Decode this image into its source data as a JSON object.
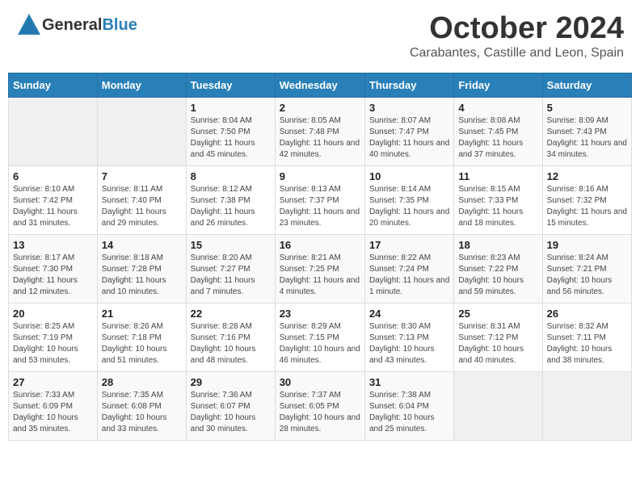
{
  "header": {
    "logo_general": "General",
    "logo_blue": "Blue",
    "month_title": "October 2024",
    "location": "Carabantes, Castille and Leon, Spain"
  },
  "days_of_week": [
    "Sunday",
    "Monday",
    "Tuesday",
    "Wednesday",
    "Thursday",
    "Friday",
    "Saturday"
  ],
  "weeks": [
    [
      {
        "day": "",
        "sunrise": "",
        "sunset": "",
        "daylight": ""
      },
      {
        "day": "",
        "sunrise": "",
        "sunset": "",
        "daylight": ""
      },
      {
        "day": "1",
        "sunrise": "Sunrise: 8:04 AM",
        "sunset": "Sunset: 7:50 PM",
        "daylight": "Daylight: 11 hours and 45 minutes."
      },
      {
        "day": "2",
        "sunrise": "Sunrise: 8:05 AM",
        "sunset": "Sunset: 7:48 PM",
        "daylight": "Daylight: 11 hours and 42 minutes."
      },
      {
        "day": "3",
        "sunrise": "Sunrise: 8:07 AM",
        "sunset": "Sunset: 7:47 PM",
        "daylight": "Daylight: 11 hours and 40 minutes."
      },
      {
        "day": "4",
        "sunrise": "Sunrise: 8:08 AM",
        "sunset": "Sunset: 7:45 PM",
        "daylight": "Daylight: 11 hours and 37 minutes."
      },
      {
        "day": "5",
        "sunrise": "Sunrise: 8:09 AM",
        "sunset": "Sunset: 7:43 PM",
        "daylight": "Daylight: 11 hours and 34 minutes."
      }
    ],
    [
      {
        "day": "6",
        "sunrise": "Sunrise: 8:10 AM",
        "sunset": "Sunset: 7:42 PM",
        "daylight": "Daylight: 11 hours and 31 minutes."
      },
      {
        "day": "7",
        "sunrise": "Sunrise: 8:11 AM",
        "sunset": "Sunset: 7:40 PM",
        "daylight": "Daylight: 11 hours and 29 minutes."
      },
      {
        "day": "8",
        "sunrise": "Sunrise: 8:12 AM",
        "sunset": "Sunset: 7:38 PM",
        "daylight": "Daylight: 11 hours and 26 minutes."
      },
      {
        "day": "9",
        "sunrise": "Sunrise: 8:13 AM",
        "sunset": "Sunset: 7:37 PM",
        "daylight": "Daylight: 11 hours and 23 minutes."
      },
      {
        "day": "10",
        "sunrise": "Sunrise: 8:14 AM",
        "sunset": "Sunset: 7:35 PM",
        "daylight": "Daylight: 11 hours and 20 minutes."
      },
      {
        "day": "11",
        "sunrise": "Sunrise: 8:15 AM",
        "sunset": "Sunset: 7:33 PM",
        "daylight": "Daylight: 11 hours and 18 minutes."
      },
      {
        "day": "12",
        "sunrise": "Sunrise: 8:16 AM",
        "sunset": "Sunset: 7:32 PM",
        "daylight": "Daylight: 11 hours and 15 minutes."
      }
    ],
    [
      {
        "day": "13",
        "sunrise": "Sunrise: 8:17 AM",
        "sunset": "Sunset: 7:30 PM",
        "daylight": "Daylight: 11 hours and 12 minutes."
      },
      {
        "day": "14",
        "sunrise": "Sunrise: 8:18 AM",
        "sunset": "Sunset: 7:28 PM",
        "daylight": "Daylight: 11 hours and 10 minutes."
      },
      {
        "day": "15",
        "sunrise": "Sunrise: 8:20 AM",
        "sunset": "Sunset: 7:27 PM",
        "daylight": "Daylight: 11 hours and 7 minutes."
      },
      {
        "day": "16",
        "sunrise": "Sunrise: 8:21 AM",
        "sunset": "Sunset: 7:25 PM",
        "daylight": "Daylight: 11 hours and 4 minutes."
      },
      {
        "day": "17",
        "sunrise": "Sunrise: 8:22 AM",
        "sunset": "Sunset: 7:24 PM",
        "daylight": "Daylight: 11 hours and 1 minute."
      },
      {
        "day": "18",
        "sunrise": "Sunrise: 8:23 AM",
        "sunset": "Sunset: 7:22 PM",
        "daylight": "Daylight: 10 hours and 59 minutes."
      },
      {
        "day": "19",
        "sunrise": "Sunrise: 8:24 AM",
        "sunset": "Sunset: 7:21 PM",
        "daylight": "Daylight: 10 hours and 56 minutes."
      }
    ],
    [
      {
        "day": "20",
        "sunrise": "Sunrise: 8:25 AM",
        "sunset": "Sunset: 7:19 PM",
        "daylight": "Daylight: 10 hours and 53 minutes."
      },
      {
        "day": "21",
        "sunrise": "Sunrise: 8:26 AM",
        "sunset": "Sunset: 7:18 PM",
        "daylight": "Daylight: 10 hours and 51 minutes."
      },
      {
        "day": "22",
        "sunrise": "Sunrise: 8:28 AM",
        "sunset": "Sunset: 7:16 PM",
        "daylight": "Daylight: 10 hours and 48 minutes."
      },
      {
        "day": "23",
        "sunrise": "Sunrise: 8:29 AM",
        "sunset": "Sunset: 7:15 PM",
        "daylight": "Daylight: 10 hours and 46 minutes."
      },
      {
        "day": "24",
        "sunrise": "Sunrise: 8:30 AM",
        "sunset": "Sunset: 7:13 PM",
        "daylight": "Daylight: 10 hours and 43 minutes."
      },
      {
        "day": "25",
        "sunrise": "Sunrise: 8:31 AM",
        "sunset": "Sunset: 7:12 PM",
        "daylight": "Daylight: 10 hours and 40 minutes."
      },
      {
        "day": "26",
        "sunrise": "Sunrise: 8:32 AM",
        "sunset": "Sunset: 7:11 PM",
        "daylight": "Daylight: 10 hours and 38 minutes."
      }
    ],
    [
      {
        "day": "27",
        "sunrise": "Sunrise: 7:33 AM",
        "sunset": "Sunset: 6:09 PM",
        "daylight": "Daylight: 10 hours and 35 minutes."
      },
      {
        "day": "28",
        "sunrise": "Sunrise: 7:35 AM",
        "sunset": "Sunset: 6:08 PM",
        "daylight": "Daylight: 10 hours and 33 minutes."
      },
      {
        "day": "29",
        "sunrise": "Sunrise: 7:36 AM",
        "sunset": "Sunset: 6:07 PM",
        "daylight": "Daylight: 10 hours and 30 minutes."
      },
      {
        "day": "30",
        "sunrise": "Sunrise: 7:37 AM",
        "sunset": "Sunset: 6:05 PM",
        "daylight": "Daylight: 10 hours and 28 minutes."
      },
      {
        "day": "31",
        "sunrise": "Sunrise: 7:38 AM",
        "sunset": "Sunset: 6:04 PM",
        "daylight": "Daylight: 10 hours and 25 minutes."
      },
      {
        "day": "",
        "sunrise": "",
        "sunset": "",
        "daylight": ""
      },
      {
        "day": "",
        "sunrise": "",
        "sunset": "",
        "daylight": ""
      }
    ]
  ]
}
